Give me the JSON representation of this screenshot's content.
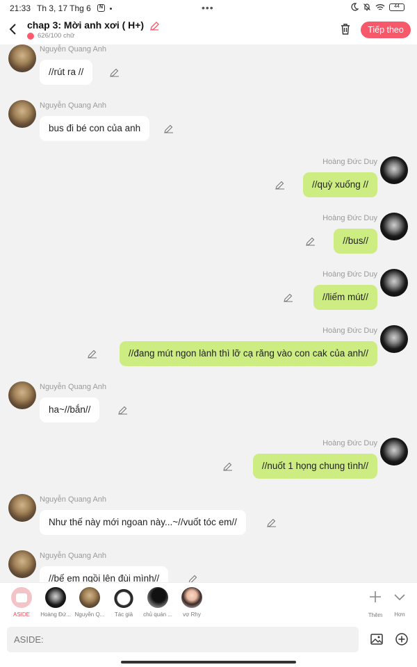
{
  "status": {
    "time": "21:33",
    "date": "Th 3, 17 Thg 6",
    "battery": "44",
    "more": "•••"
  },
  "header": {
    "title": "chap 3: Mời anh xơi ( H+)",
    "word_count": "626/100 chữ",
    "next_label": "Tiếp theo"
  },
  "messages": [
    {
      "sender": "Nguyễn Quang Anh",
      "text": "//rút ra //"
    },
    {
      "sender": "Nguyễn Quang Anh",
      "text": "bus đi bé con của anh"
    },
    {
      "sender": "Hoàng Đức Duy",
      "text": "//quỳ xuống //"
    },
    {
      "sender": "Hoàng Đức Duy",
      "text": "//bus//"
    },
    {
      "sender": "Hoàng Đức Duy",
      "text": "//liếm mút//"
    },
    {
      "sender": "Hoàng Đức Duy",
      "text": "//đang mút ngon lành thì lỡ cạ răng vào con cak của anh//"
    },
    {
      "sender": "Nguyễn Quang Anh",
      "text": "ha~//bắn//"
    },
    {
      "sender": "Hoàng Đức Duy",
      "text": "//nuốt 1 họng chung tình//"
    },
    {
      "sender": "Nguyễn Quang Anh",
      "text": "Như thế này mới ngoan này...~//vuốt tóc em//"
    },
    {
      "sender": "Nguyễn Quang Anh",
      "text": "//bế em ngồi lên đùi mình//"
    }
  ],
  "characters": [
    {
      "label": "ASIDE"
    },
    {
      "label": "Hoàng Đứ..."
    },
    {
      "label": "Nguyễn Q..."
    },
    {
      "label": "Tác giả"
    },
    {
      "label": "chủ quán ..."
    },
    {
      "label": "vợ Rhy"
    }
  ],
  "actions": {
    "add_label": "Thêm",
    "more_label": "Hơn"
  },
  "input": {
    "placeholder": "ASIDE:"
  },
  "colors": {
    "accent": "#f7596a",
    "bubble_right": "#cdec82",
    "bubble_left": "#ffffff"
  }
}
